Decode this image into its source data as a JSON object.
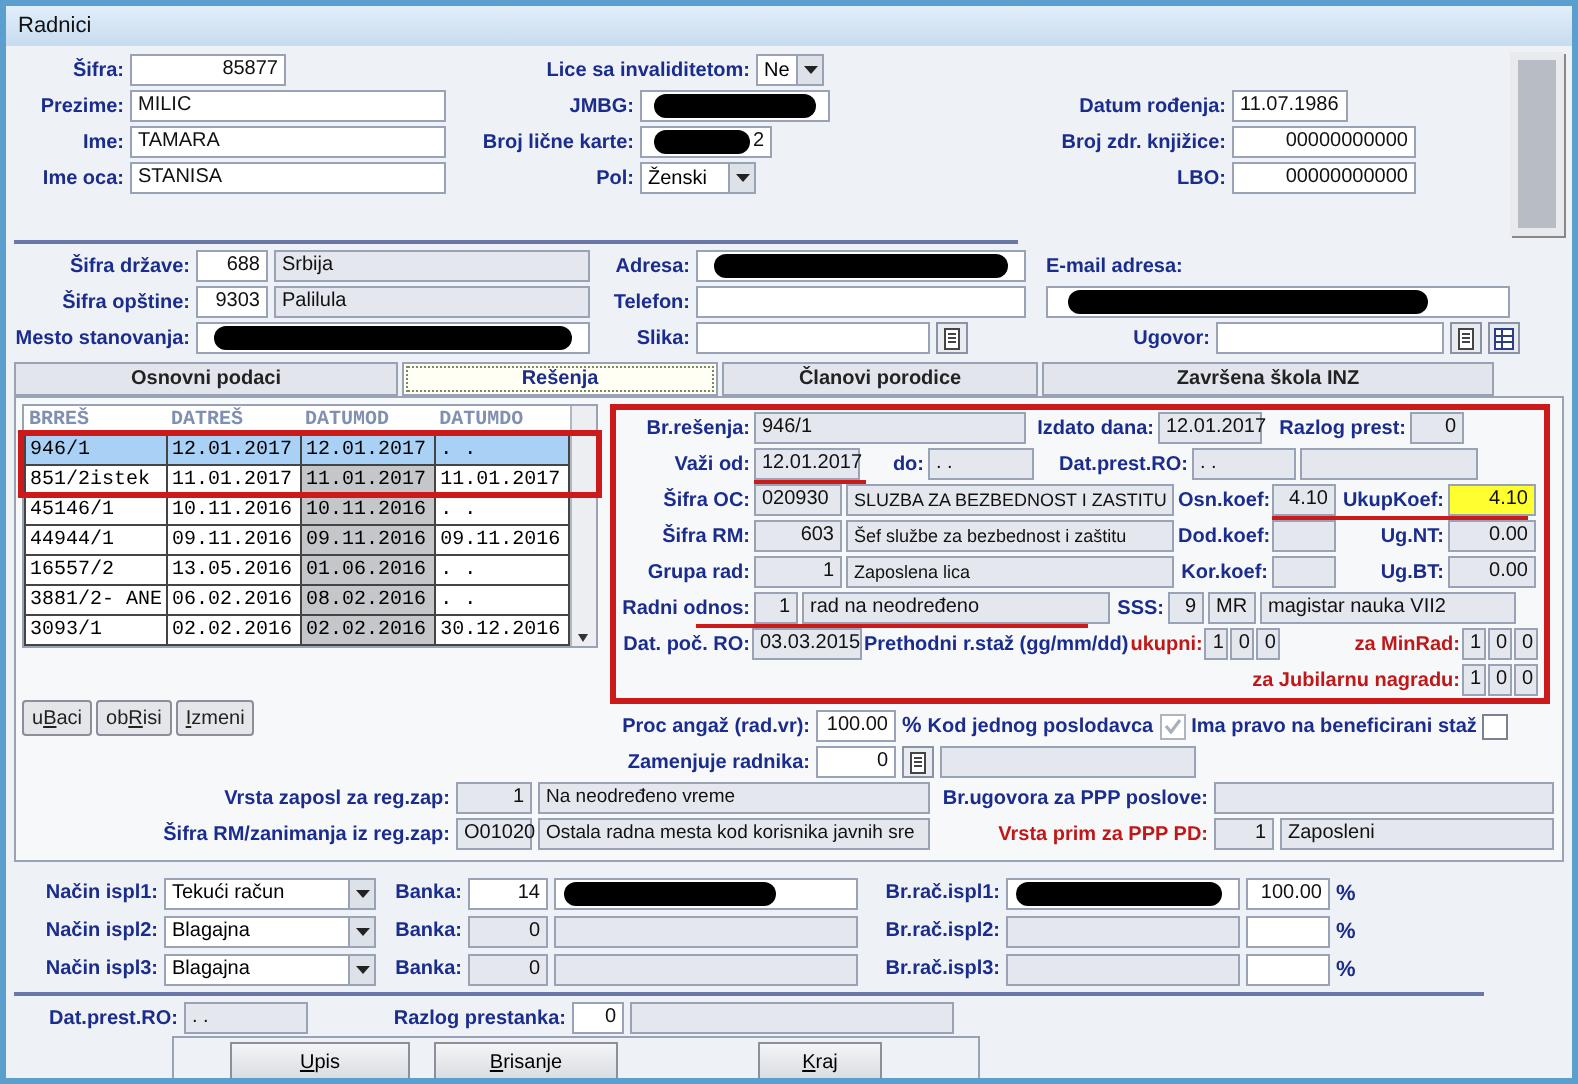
{
  "window": {
    "title": "Radnici"
  },
  "personal": [
    {
      "label": "Šifra:",
      "value": "85877"
    },
    {
      "label": "Prezime:",
      "value": "MILIC"
    },
    {
      "label": "Ime:",
      "value": "TAMARA"
    },
    {
      "label": "Ime oca:",
      "value": "STANISA"
    }
  ],
  "identity": [
    {
      "kind": "select",
      "label": "Lice sa invaliditetom:",
      "value": "Ne"
    },
    {
      "kind": "text",
      "label": "JMBG:",
      "redacted": true
    },
    {
      "kind": "text",
      "label": "Broj lične karte:",
      "value": "2",
      "redacted": true
    },
    {
      "kind": "select",
      "label": "Pol:",
      "value": "Ženski"
    }
  ],
  "documents": [
    {
      "label": "Datum rođenja:",
      "value": "11.07.1986"
    },
    {
      "label": "Broj zdr. knjižice:",
      "value": "00000000000"
    },
    {
      "label": "LBO:",
      "value": "00000000000"
    }
  ],
  "residence": [
    {
      "label": "Šifra države:",
      "code": "688",
      "name": "Srbija"
    },
    {
      "label": "Šifra opštine:",
      "code": "9303",
      "name": "Palilula"
    },
    {
      "label": "Mesto stanovanja:",
      "redacted": true
    }
  ],
  "contact": [
    {
      "label": "Adresa:",
      "redacted": true
    },
    {
      "label": "Telefon:"
    },
    {
      "label": "Slika:"
    }
  ],
  "email": {
    "label": "E-mail adresa:",
    "redacted": true
  },
  "contract": {
    "label": "Ugovor:"
  },
  "tabs": [
    {
      "label": "Osnovni podaci",
      "selected": false
    },
    {
      "label": "Rešenja",
      "selected": true
    },
    {
      "label": "Članovi porodice",
      "selected": false
    },
    {
      "label": "Završena škola   INZ",
      "selected": false
    }
  ],
  "decisions_table": {
    "columns": [
      "BRREŠ",
      "DATREŠ",
      "DATUMOD",
      "DATUMDO"
    ],
    "rows": [
      {
        "cells": [
          "946/1",
          "12.01.2017",
          "12.01.2017",
          ". ."
        ],
        "selected": true
      },
      {
        "cells": [
          "851/2istek",
          "11.01.2017",
          "11.01.2017",
          "11.01.2017"
        ],
        "selected": false
      },
      {
        "cells": [
          "45146/1",
          "10.11.2016",
          "10.11.2016",
          ". ."
        ],
        "selected": false
      },
      {
        "cells": [
          "44944/1",
          "09.11.2016",
          "09.11.2016",
          "09.11.2016"
        ],
        "selected": false
      },
      {
        "cells": [
          "16557/2",
          "13.05.2016",
          "01.06.2016",
          ". ."
        ],
        "selected": false
      },
      {
        "cells": [
          "3881/2- ANE",
          "06.02.2016",
          "08.02.2016",
          ". ."
        ],
        "selected": false
      },
      {
        "cells": [
          "3093/1",
          "02.02.2016",
          "02.02.2016",
          "30.12.2016"
        ],
        "selected": false
      }
    ]
  },
  "table_buttons": [
    {
      "before": "u",
      "key": "B",
      "after": "aci"
    },
    {
      "before": "ob",
      "key": "R",
      "after": "isi"
    },
    {
      "key": "I",
      "after": "zmeni"
    }
  ],
  "decision": {
    "number": {
      "label": "Br.rešenja:",
      "value": "946/1"
    },
    "issued": {
      "label": "Izdato dana:",
      "value": "12.01.2017"
    },
    "end_reason": {
      "label": "Razlog prest:",
      "value": "0"
    },
    "valid_from": {
      "label": "Važi od:",
      "value": "12.01.2017"
    },
    "valid_to": {
      "label": "do:",
      "value": ". ."
    },
    "end_date": {
      "label": "Dat.prest.RO:",
      "value": ". ."
    },
    "units": [
      {
        "label": "Šifra OC:",
        "code": "020930",
        "name": "SLUZBA ZA BEZBEDNOST I ZASTITU"
      },
      {
        "label": "Šifra RM:",
        "code": "603",
        "name": "Šef službe za bezbednost i zaštitu"
      },
      {
        "label": "Grupa rad:",
        "code": "1",
        "name": "Zaposlena lica"
      }
    ],
    "coefficients": [
      {
        "label": "Osn.koef:",
        "value": "4.10"
      },
      {
        "label": "Dod.koef:"
      },
      {
        "label": "Kor.koef:"
      }
    ],
    "totals": [
      {
        "label": "UkupKoef:",
        "value": "4.10",
        "highlighted": true
      },
      {
        "label": "Ug.NT:",
        "value": "0.00",
        "highlighted": false
      },
      {
        "label": "Ug.BT:",
        "value": "0.00",
        "highlighted": false
      }
    ],
    "employment": {
      "label": "Radni odnos:",
      "code": "1",
      "name": "rad na neodređeno"
    },
    "education": {
      "label": "SSS:",
      "code": "9",
      "degree": "MR",
      "name": "magistar nauka  VII2"
    },
    "start_date": {
      "label": "Dat. poč. RO:",
      "value": "03.03.2015"
    },
    "experience": {
      "label": "Prethodni r.staž (gg/mm/dd)",
      "total_label": "ukupni:",
      "total": [
        "1",
        "0",
        "0"
      ],
      "min_label": "za MinRad:",
      "min": [
        "1",
        "0",
        "0"
      ],
      "jubilee_label": "za Jubilarnu nagradu:",
      "jubilee": [
        "1",
        "0",
        "0"
      ]
    }
  },
  "engagement": {
    "label": "Proc angaž (rad.vr):",
    "value": "100.00",
    "unit": "%"
  },
  "checks": [
    {
      "label": "Kod jednog poslodavca",
      "checked": true,
      "disabled": true
    },
    {
      "label": "Ima pravo na beneficirani staž",
      "checked": false,
      "disabled": false
    }
  ],
  "replaces": {
    "label": "Zamenjuje radnika:",
    "value": "0"
  },
  "registry": [
    {
      "label": "Vrsta zaposl za reg.zap:",
      "code": "1",
      "name": "Na neodređeno vreme"
    },
    {
      "label": "Šifra RM/zanimanja iz reg.zap:",
      "code": "O01020",
      "name": "Ostala radna mesta kod korisnika javnih sre"
    }
  ],
  "ppp": [
    {
      "label": "Br.ugovora za PPP poslove:",
      "emphasis": false
    },
    {
      "label": "Vrsta prim za PPP PD:",
      "emphasis": true,
      "code": "1",
      "name": "Zaposleni"
    }
  ],
  "payments": [
    {
      "label": "Način ispl1:",
      "method": "Tekući račun",
      "bank_label": "Banka:",
      "bank": "14",
      "enabled": true,
      "bank_name_redacted": true,
      "account_label": "Br.rač.ispl1:",
      "account_redacted": true,
      "share": "100.00",
      "unit": "%"
    },
    {
      "label": "Način ispl2:",
      "method": "Blagajna",
      "bank_label": "Banka:",
      "bank": "0",
      "enabled": false,
      "account_label": "Br.rač.ispl2:",
      "unit": "%"
    },
    {
      "label": "Način ispl3:",
      "method": "Blagajna",
      "bank_label": "Banka:",
      "bank": "0",
      "enabled": false,
      "account_label": "Br.rač.ispl3:",
      "unit": "%"
    }
  ],
  "termination": {
    "date_label": "Dat.prest.RO:",
    "date": ". .",
    "reason_label": "Razlog prestanka:",
    "reason": "0"
  },
  "actions": [
    {
      "key": "U",
      "after": "pis"
    },
    {
      "key": "B",
      "after": "risanje"
    },
    {
      "key": "K",
      "after": "raj"
    }
  ]
}
